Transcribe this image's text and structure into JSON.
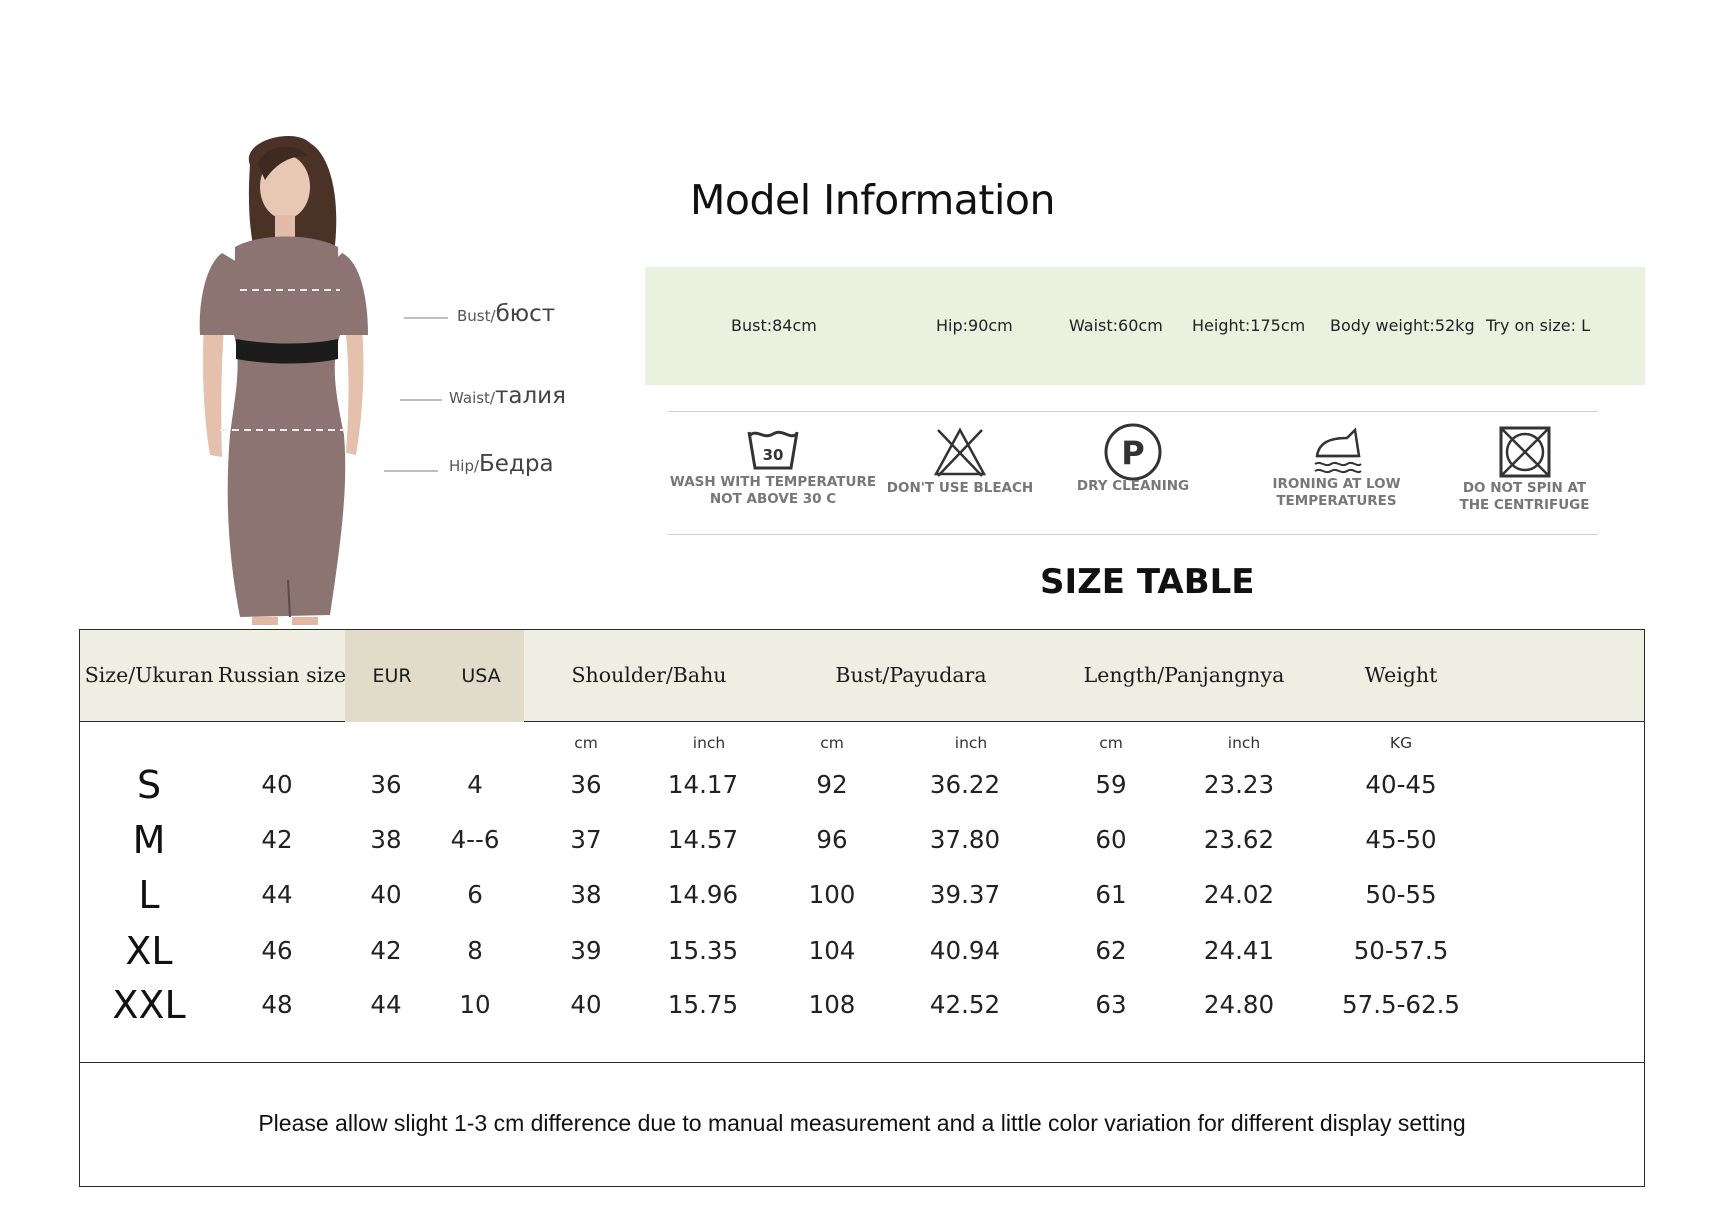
{
  "figure": {
    "labels": [
      {
        "en": "Bust/",
        "ru": "бюст"
      },
      {
        "en": "Waist/",
        "ru": "талия"
      },
      {
        "en": "Hip/",
        "ru": "Бедра"
      }
    ],
    "dress_color": "#8b7472"
  },
  "model_info": {
    "title": "Model Information",
    "items": [
      "Bust:84cm",
      "Hip:90cm",
      "Waist:60cm",
      "Height:175cm",
      "Body weight:52kg",
      "Try on size: L"
    ],
    "bar_color": "#ebf1df"
  },
  "care": {
    "items": [
      {
        "icon": "wash-30-icon",
        "badge": "30",
        "label": "WASH WITH TEMPERATURE\nNOT ABOVE 30 C"
      },
      {
        "icon": "no-bleach-icon",
        "label": "DON'T USE BLEACH"
      },
      {
        "icon": "dry-cleaning-icon",
        "badge": "P",
        "label": "DRY CLEANING"
      },
      {
        "icon": "iron-low-icon",
        "label": "IRONING AT LOW\nTEMPERATURES"
      },
      {
        "icon": "no-spin-icon",
        "label": "DO NOT SPIN AT\nTHE CENTRIFUGE"
      }
    ]
  },
  "size_table": {
    "title": "SIZE TABLE",
    "headers": [
      "Size/Ukuran",
      "Russian size",
      "EUR",
      "USA",
      "Shoulder/Bahu",
      "Bust/Payudara",
      "Length/Panjangnya",
      "Weight"
    ],
    "units": [
      "cm",
      "inch",
      "cm",
      "inch",
      "cm",
      "inch",
      "KG"
    ],
    "rows": [
      [
        "S",
        "40",
        "36",
        "4",
        "36",
        "14.17",
        "92",
        "36.22",
        "59",
        "23.23",
        "40-45"
      ],
      [
        "M",
        "42",
        "38",
        "4--6",
        "37",
        "14.57",
        "96",
        "37.80",
        "60",
        "23.62",
        "45-50"
      ],
      [
        "L",
        "44",
        "40",
        "6",
        "38",
        "14.96",
        "100",
        "39.37",
        "61",
        "24.02",
        "50-55"
      ],
      [
        "XL",
        "46",
        "42",
        "8",
        "39",
        "15.35",
        "104",
        "40.94",
        "62",
        "24.41",
        "50-57.5"
      ],
      [
        "XXL",
        "48",
        "44",
        "10",
        "40",
        "15.75",
        "108",
        "42.52",
        "63",
        "24.80",
        "57.5-62.5"
      ]
    ],
    "header_bg": "#efeee3",
    "highlight_bg": "#e1dcc9",
    "note": "Please allow slight 1-3 cm difference due to manual measurement and a little color variation for different display setting"
  }
}
